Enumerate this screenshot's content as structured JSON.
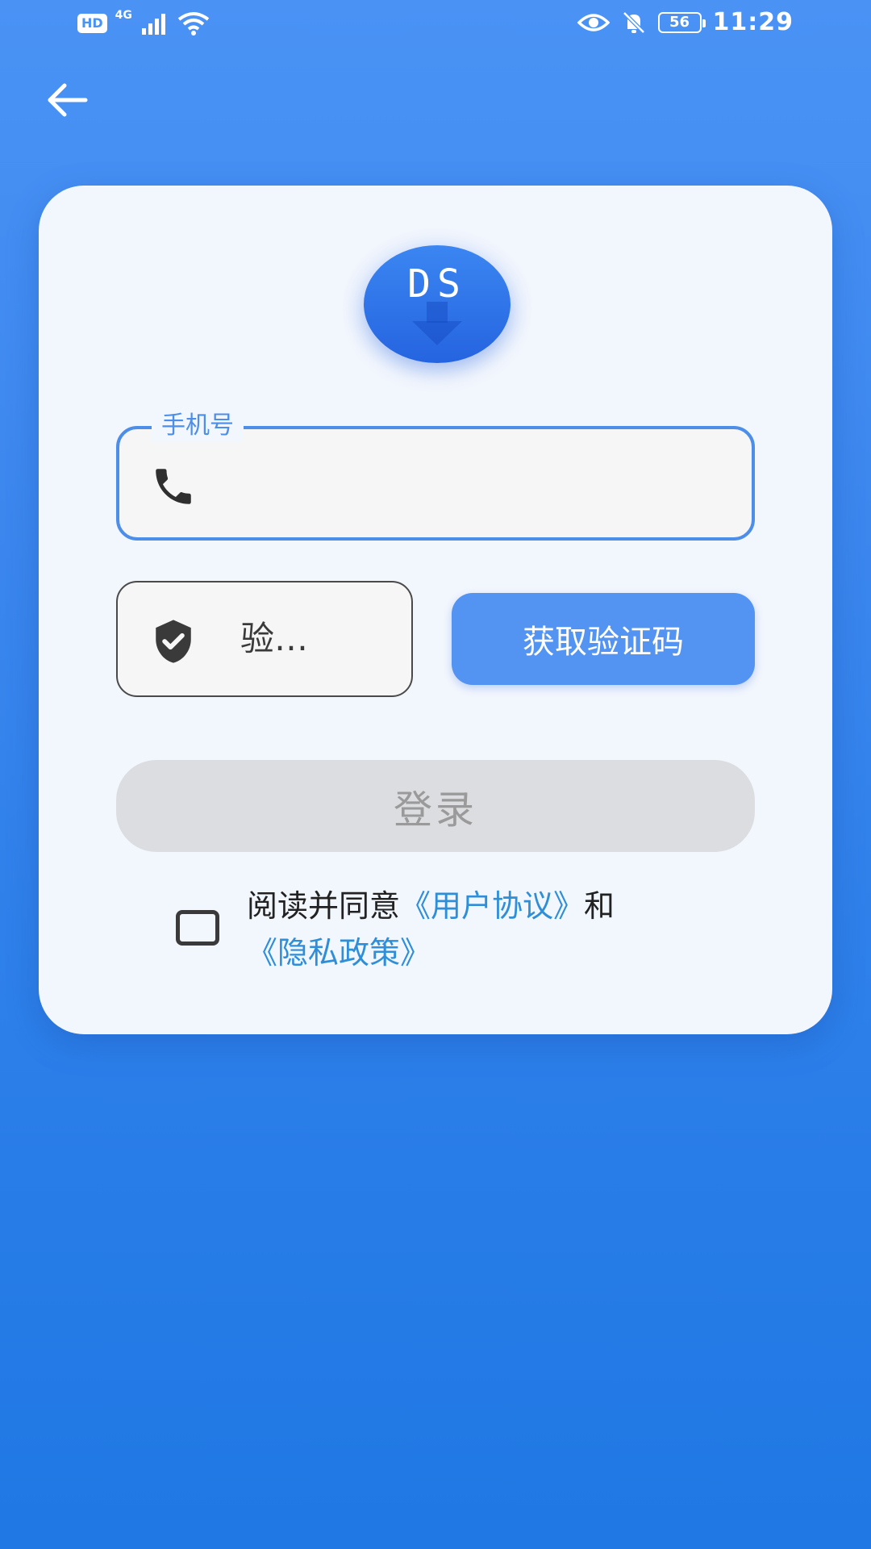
{
  "status_bar": {
    "hd": "HD",
    "network": "4G",
    "battery": "56",
    "time": "11:29"
  },
  "icons": {
    "back": "arrow-left-icon",
    "phone": "phone-icon",
    "shield": "shield-check-icon"
  },
  "logo": {
    "text": "DS"
  },
  "form": {
    "phone_label": "手机号",
    "phone_value": "",
    "code_placeholder": "验…",
    "get_code_label": "获取验证码",
    "login_label": "登录"
  },
  "agreement": {
    "prefix": "阅读并同意",
    "user_agreement": "《用户协议》",
    "and": "和",
    "privacy_policy": "《隐私政策》",
    "checked": false
  },
  "colors": {
    "background": "#3d88ef",
    "card": "#f2f6fd",
    "accent": "#4d8ee8",
    "button": "#5394f2",
    "disabled": "#dcdde0",
    "link": "#2f8ed8"
  }
}
